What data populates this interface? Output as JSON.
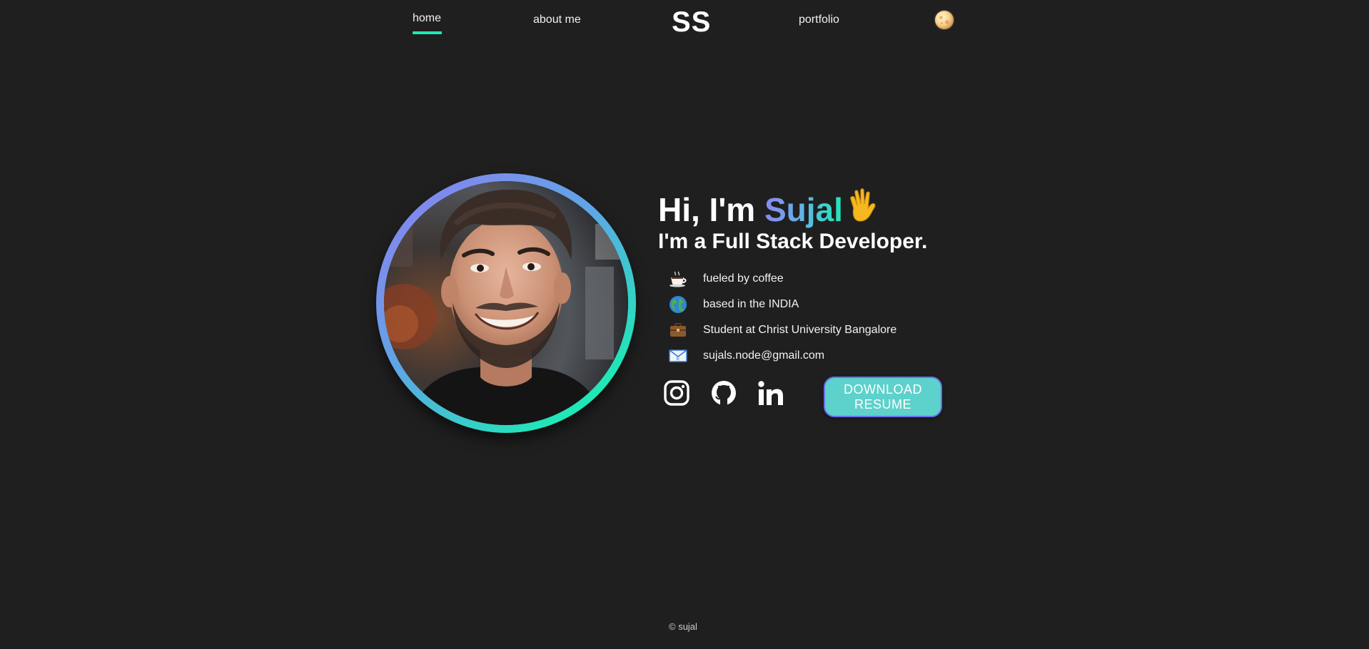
{
  "nav": {
    "home": "home",
    "about": "about me",
    "logo": "SS",
    "portfolio": "portfolio"
  },
  "hero": {
    "greeting_prefix": "Hi, I'm ",
    "name": "Sujal",
    "subtitle": "I'm a Full Stack Developer.",
    "facts": [
      {
        "icon": "coffee-icon",
        "text": "fueled by coffee"
      },
      {
        "icon": "globe-icon",
        "text": "based in the INDIA"
      },
      {
        "icon": "briefcase-icon",
        "text": "Student at Christ University Bangalore"
      },
      {
        "icon": "email-icon",
        "text": "sujals.node@gmail.com"
      }
    ],
    "resume_button": "DOWNLOAD RESUME"
  },
  "social": [
    "instagram-icon",
    "github-icon",
    "linkedin-icon"
  ],
  "footer": "© sujal",
  "colors": {
    "background": "#1f1f1f",
    "accent": "#1de9b6",
    "gradient_start": "#8f7cf0",
    "button_bg": "#5dd1cb",
    "button_border": "#6a6ff0"
  }
}
